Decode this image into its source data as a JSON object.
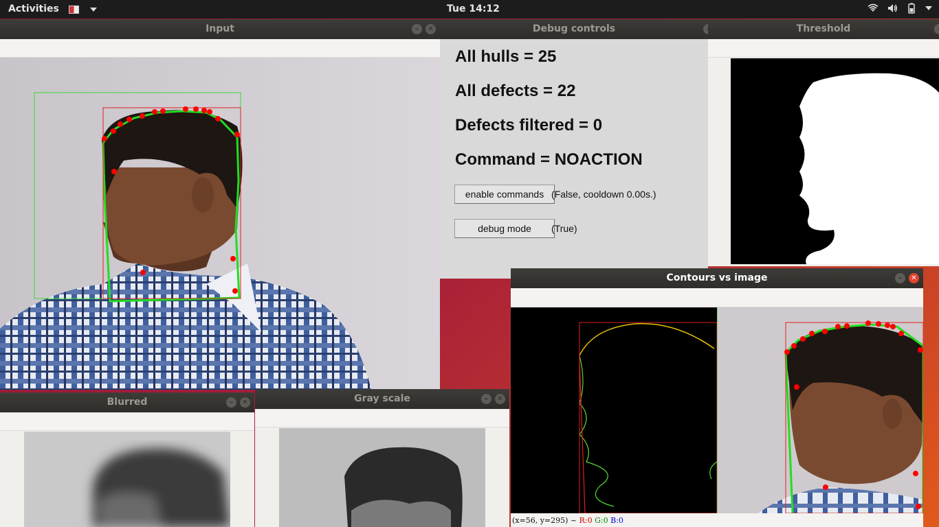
{
  "topbar": {
    "activities": "Activities",
    "clock": "Tue 14:12"
  },
  "windows": {
    "input": {
      "title": "Input"
    },
    "debug": {
      "title": "Debug controls",
      "all_hulls": "All hulls = 25",
      "all_defects": "All defects = 22",
      "defects_filtered": "Defects filtered = 0",
      "command": "Command = NOACTION",
      "enable_commands_label": "enable commands",
      "enable_commands_state": "(False, cooldown 0.00s.)",
      "debug_mode_label": "debug mode",
      "debug_mode_state": "(True)"
    },
    "threshold": {
      "title": "Threshold"
    },
    "blurred": {
      "title": "Blurred"
    },
    "grayscale": {
      "title": "Gray scale"
    },
    "contours": {
      "title": "Contours vs image",
      "status_coords": "(x=56, y=295) ~",
      "status_r": "R:0",
      "status_g": "G:0",
      "status_b": "B:0"
    }
  },
  "colors": {
    "hull": "#22dd22",
    "defect": "#ff0000",
    "bbox_green": "#33dd33",
    "bbox_red": "#dd2222"
  },
  "icons": [
    "app-flag-icon",
    "dropdown-caret-icon",
    "wifi-icon",
    "volume-icon",
    "battery-icon",
    "system-menu-caret-icon",
    "minimize-icon",
    "close-icon"
  ]
}
